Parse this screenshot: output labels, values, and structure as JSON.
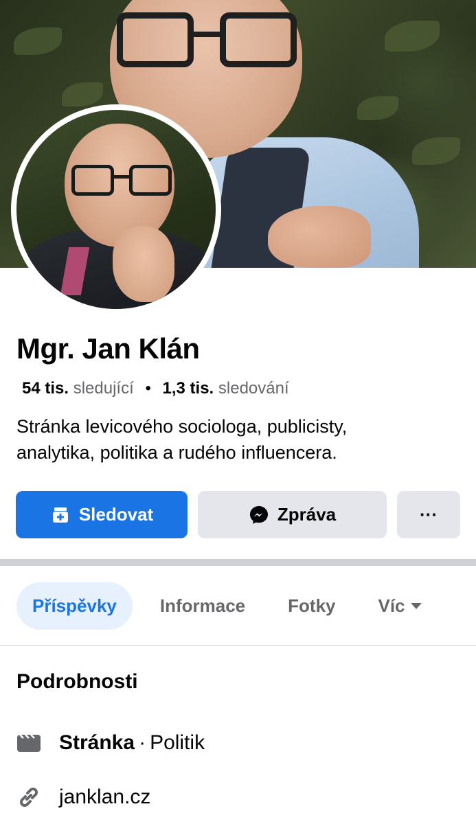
{
  "profile": {
    "name": "Mgr. Jan Klán",
    "followers_count": "54 tis.",
    "followers_label": "sledující",
    "following_count": "1,3 tis.",
    "following_label": "sledování",
    "bio_line1": "Stránka levicového sociologa, publicisty,",
    "bio_line2": "analytika, politika a rudého influencera."
  },
  "actions": {
    "follow_label": "Sledovat",
    "message_label": "Zpráva",
    "more_label": "···",
    "follow_icon": "follow-page-icon",
    "message_icon": "messenger-icon"
  },
  "tabs": [
    {
      "label": "Příspěvky",
      "active": true
    },
    {
      "label": "Informace",
      "active": false
    },
    {
      "label": "Fotky",
      "active": false
    },
    {
      "label": "Víc",
      "active": false
    }
  ],
  "details": {
    "title": "Podrobnosti",
    "type_label": "Stránka",
    "type_separator": "·",
    "type_value": "Politik",
    "website": "janklan.cz",
    "type_icon": "page-icon",
    "website_icon": "link-icon"
  },
  "colors": {
    "accent": "#1b74e4",
    "button_bg": "#e4e6eb",
    "tab_active_bg": "#e7f0fd",
    "secondary_text": "#65676b"
  }
}
